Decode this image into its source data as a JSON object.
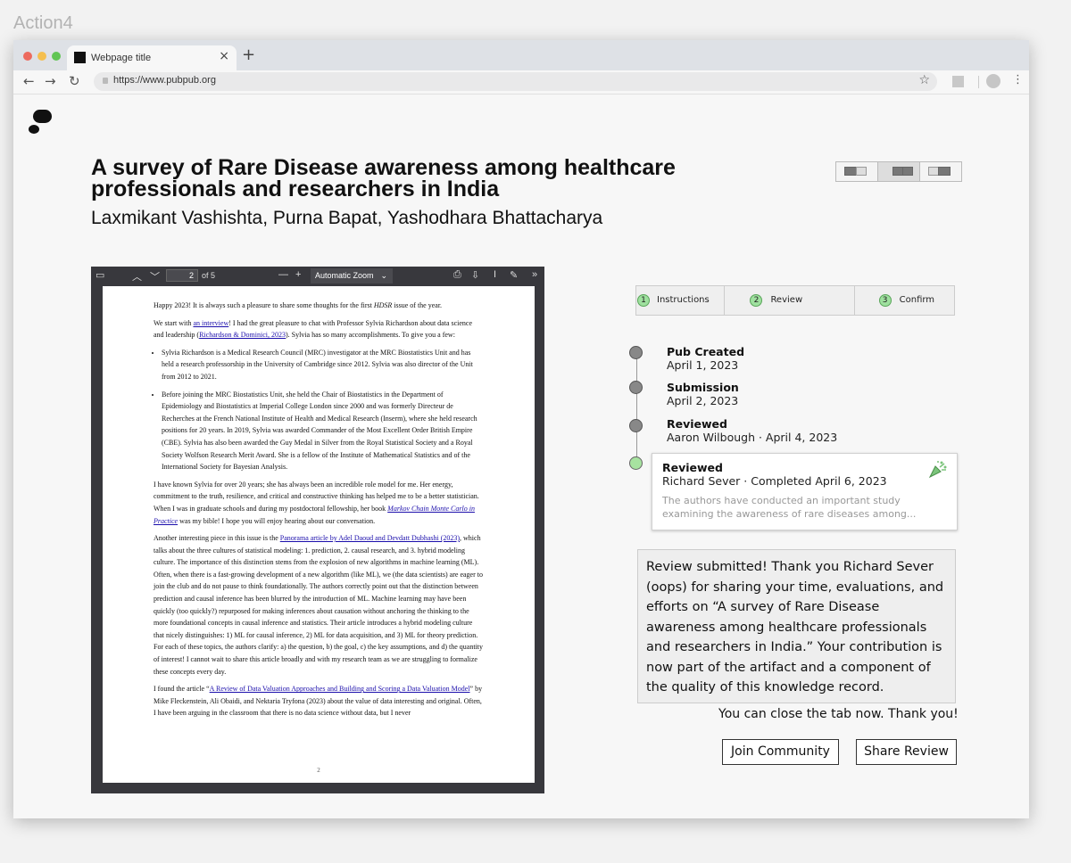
{
  "frame_label": "Action4",
  "browser": {
    "tab_title": "Webpage title",
    "tab_close": "×",
    "new_tab": "+",
    "url": "https://www.pubpub.org",
    "nav": {
      "back": "←",
      "forward": "→",
      "reload": "↻",
      "star": "☆",
      "menu": "⋮"
    }
  },
  "pub": {
    "title": "A survey of Rare Disease awareness among healthcare professionals and researchers in India",
    "authors": "Laxmikant Vashishta, Purna Bapat, Yashodhara Bhattacharya"
  },
  "pdf_viewer": {
    "page_current": "2",
    "page_of": "of 5",
    "zoom": "Automatic Zoom",
    "page_number_footer": "2",
    "text": {
      "p1_a": "Happy 2023! It is always such a pleasure to share some thoughts for the first ",
      "p1_em": "HDSR",
      "p1_b": " issue of the year.",
      "p2_a": "We start with ",
      "p2_link1": "an interview",
      "p2_b": "! I had the great pleasure to chat with Professor Sylvia Richardson about data science and leadership (",
      "p2_link2": "Richardson & Dominici, 2023",
      "p2_c": "). Sylvia has so many accomplishments. To give you a few:",
      "li1": "Sylvia Richardson is a Medical Research Council (MRC) investigator at the MRC Biostatistics Unit and has held a research professorship in the University of Cambridge since 2012. Sylvia was also director of the Unit from 2012 to 2021.",
      "li2": "Before joining the MRC Biostatistics Unit, she held the Chair of Biostatistics in the Department of Epidemiology and Biostatistics at Imperial College London since 2000 and was formerly Directeur de Recherches at the French National Institute of Health and Medical Research (Inserm), where she held research positions for 20 years. In 2019, Sylvia was awarded Commander of the Most Excellent Order British Empire (CBE). Sylvia has also been awarded the Guy Medal in Silver from the Royal Statistical Society and a Royal Society Wolfson Research Merit Award. She is a fellow of the Institute of Mathematical Statistics and of the International Society for Bayesian Analysis.",
      "p3_a": "I have known Sylvia for over 20 years; she has always been an incredible role model for me. Her energy, commitment to the truth, resilience, and critical and constructive thinking has helped me to be a better statistician. When I was in graduate schools and during my postdoctoral fellowship, her book ",
      "p3_link": "Markov Chain Monte Carlo in Practice",
      "p3_b": " was my bible! I hope you will enjoy hearing about our conversation.",
      "p4_a": "Another interesting piece in this issue is the ",
      "p4_link": "Panorama article by Adel Daoud and Devdatt Dubhashi (2023)",
      "p4_b": ", which talks about the three cultures of statistical modeling: 1. prediction, 2. causal research, and 3. hybrid modeling culture. The importance of this distinction stems from the explosion of new algorithms in machine learning (ML). Often, when there is a fast-growing development of a new algorithm (like ML), we (the data scientists) are eager to join the club and do not pause to think foundationally. The authors correctly point out that the distinction between prediction and causal inference has been blurred by the introduction of ML. Machine learning may have been quickly (too quickly?) repurposed for making inferences about causation without anchoring the thinking to the more foundational concepts in causal inference and statistics. Their article introduces a hybrid modeling culture that nicely distinguishes: 1) ML for causal inference, 2) ML for data acquisition, and 3) ML for theory prediction. For each of these topics, the authors clarify: a) the question, b) the goal, c) the key assumptions, and d) the quantity of interest! I cannot wait to share this article broadly and with my research team as we are struggling to formalize these concepts every day.",
      "p5_a": "I found the article “",
      "p5_link": "A Review of Data Valuation Approaches and Building and Scoring a Data Valuation Model",
      "p5_b": "” by Mike Fleckenstein, Ali Obaidi, and Nektaria Tryfona (2023) about the value of data interesting and original. Often, I have been arguing in the classroom that there is no data science without data, but I never"
    }
  },
  "steps": [
    {
      "num": "1",
      "label": "Instructions"
    },
    {
      "num": "2",
      "label": "Review"
    },
    {
      "num": "3",
      "label": "Confirm"
    }
  ],
  "timeline": [
    {
      "title": "Pub Created",
      "sub": "April 1, 2023"
    },
    {
      "title": "Submission",
      "sub": "April 2, 2023"
    },
    {
      "title": "Reviewed",
      "sub": "Aaron Wilbough  ·  April 4, 2023"
    }
  ],
  "review_card": {
    "title": "Reviewed",
    "sub": "Richard Sever  ·  Completed April 6, 2023",
    "excerpt": "The authors have conducted an important study examining the awareness of rare diseases among..."
  },
  "message": "Review submitted! Thank you Richard Sever (oops) for sharing your time, evaluations, and efforts on “A survey of Rare Disease awareness among healthcare professionals and researchers in India.” Your contribution is now part of the artifact and a component of the quality of this knowledge record.",
  "close_note": "You can close the tab now. Thank you!",
  "buttons": {
    "join": "Join Community",
    "share": "Share Review"
  },
  "colors": {
    "step_green": "#9ee09e",
    "timeline_gray": "#888888",
    "timeline_green": "#a7e3a0",
    "link_blue": "#1a0dab"
  }
}
